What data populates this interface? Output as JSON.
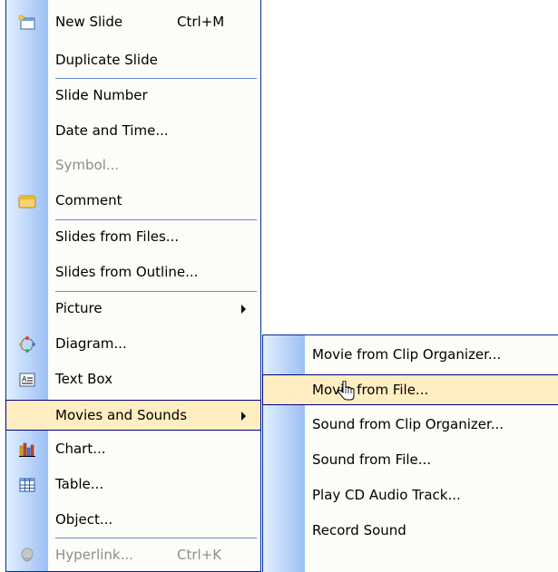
{
  "main_menu": {
    "items": [
      {
        "label": "New Slide",
        "shortcut": "Ctrl+M",
        "icon": "new-slide-icon"
      },
      {
        "label": "Duplicate Slide"
      },
      {
        "label": "Slide Number"
      },
      {
        "label": "Date and Time..."
      },
      {
        "label": "Symbol...",
        "disabled": true
      },
      {
        "label": "Comment",
        "icon": "comment-icon"
      },
      {
        "label": "Slides from Files..."
      },
      {
        "label": "Slides from Outline..."
      },
      {
        "label": "Picture",
        "submenu": true
      },
      {
        "label": "Diagram...",
        "icon": "diagram-icon"
      },
      {
        "label": "Text Box",
        "icon": "text-box-icon"
      },
      {
        "label": "Movies and Sounds",
        "submenu": true,
        "highlighted": true
      },
      {
        "label": "Chart...",
        "icon": "chart-icon"
      },
      {
        "label": "Table...",
        "icon": "table-icon"
      },
      {
        "label": "Object..."
      },
      {
        "label": "Hyperlink...",
        "shortcut": "Ctrl+K",
        "icon": "hyperlink-icon",
        "disabled": true
      }
    ]
  },
  "sub_menu": {
    "items": [
      {
        "label": "Movie from Clip Organizer..."
      },
      {
        "label": "Movie from File...",
        "highlighted": true
      },
      {
        "label": "Sound from Clip Organizer..."
      },
      {
        "label": "Sound from File..."
      },
      {
        "label": "Play CD Audio Track..."
      },
      {
        "label": "Record Sound"
      }
    ]
  },
  "colors": {
    "menu_border": "#002d96",
    "icon_gutter_light": "#e3efff",
    "icon_gutter_dark": "#9bbff4",
    "highlight_fill": "#ffeec2",
    "highlight_border": "#000080",
    "separator": "#6a8ccb",
    "disabled_text": "#8d8d8d"
  }
}
